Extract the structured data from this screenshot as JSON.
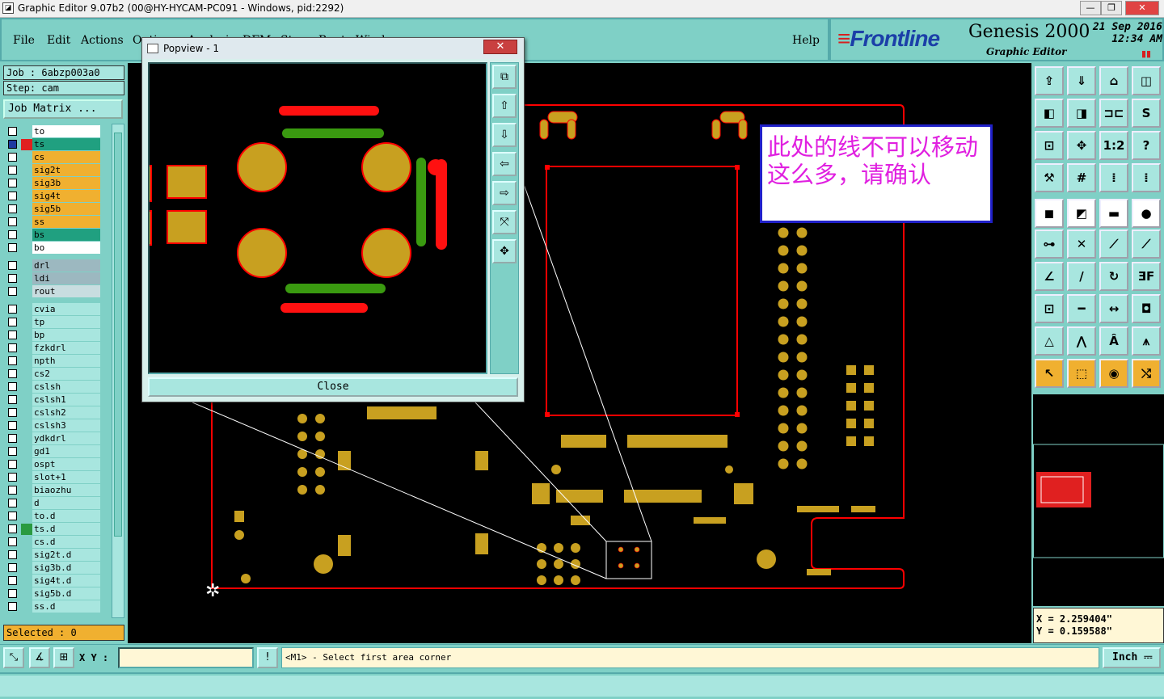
{
  "window": {
    "title": "Graphic Editor 9.07b2 (00@HY-HYCAM-PC091 - Windows, pid:2292)",
    "min": "—",
    "max": "❐",
    "close": "✕"
  },
  "menu": {
    "items": [
      "File",
      "Edit",
      "Actions",
      "Options",
      "Analysis",
      "DFM",
      "Step",
      "Rout",
      "Window"
    ],
    "help": "Help"
  },
  "brand": {
    "logo": "Frontline",
    "product": "Genesis 2000",
    "subtitle": "Graphic Editor",
    "date": "21 Sep 2016",
    "time": "12:34 AM"
  },
  "job": {
    "job_line": "Job : 6abzp003a0",
    "step_line": "Step: cam",
    "job_matrix": "Job Matrix ..."
  },
  "layers": [
    {
      "name": "to",
      "color": "#ffffff"
    },
    {
      "name": "ts",
      "color": "#20a080",
      "active": true
    },
    {
      "name": "cs",
      "color": "#f0b030"
    },
    {
      "name": "sig2t",
      "color": "#f0b030"
    },
    {
      "name": "sig3b",
      "color": "#f0b030"
    },
    {
      "name": "sig4t",
      "color": "#f0b030"
    },
    {
      "name": "sig5b",
      "color": "#f0b030"
    },
    {
      "name": "ss",
      "color": "#f0b030"
    },
    {
      "name": "bs",
      "color": "#20a080"
    },
    {
      "name": "bo",
      "color": "#ffffff"
    },
    {
      "name": "drl",
      "color": "#9cb8c0"
    },
    {
      "name": "ldi",
      "color": "#9cb8c0"
    },
    {
      "name": "rout",
      "color": "#c8dde0"
    },
    {
      "name": "cvia",
      "color": "#a8e6df"
    },
    {
      "name": "tp",
      "color": "#a8e6df"
    },
    {
      "name": "bp",
      "color": "#a8e6df"
    },
    {
      "name": "fzkdrl",
      "color": "#a8e6df"
    },
    {
      "name": "npth",
      "color": "#a8e6df"
    },
    {
      "name": "cs2",
      "color": "#a8e6df"
    },
    {
      "name": "cslsh",
      "color": "#a8e6df"
    },
    {
      "name": "cslsh1",
      "color": "#a8e6df"
    },
    {
      "name": "cslsh2",
      "color": "#a8e6df"
    },
    {
      "name": "cslsh3",
      "color": "#a8e6df"
    },
    {
      "name": "ydkdrl",
      "color": "#a8e6df"
    },
    {
      "name": "gd1",
      "color": "#a8e6df"
    },
    {
      "name": "ospt",
      "color": "#a8e6df"
    },
    {
      "name": "slot+1",
      "color": "#a8e6df"
    },
    {
      "name": "biaozhu",
      "color": "#a8e6df"
    },
    {
      "name": "d",
      "color": "#a8e6df"
    },
    {
      "name": "to.d",
      "color": "#a8e6df"
    },
    {
      "name": "ts.d",
      "color": "#a8e6df"
    },
    {
      "name": "cs.d",
      "color": "#a8e6df"
    },
    {
      "name": "sig2t.d",
      "color": "#a8e6df"
    },
    {
      "name": "sig3b.d",
      "color": "#a8e6df"
    },
    {
      "name": "sig4t.d",
      "color": "#a8e6df"
    },
    {
      "name": "sig5b.d",
      "color": "#a8e6df"
    },
    {
      "name": "ss.d",
      "color": "#a8e6df"
    }
  ],
  "selected_label": "Selected : 0",
  "popview": {
    "title": "Popview - 1",
    "close_x": "✕",
    "close_label": "Close"
  },
  "note": "此处的线不可以移动这么多，请确认",
  "coords": {
    "x": "X = 2.259404\"",
    "y": "Y = 0.159588\""
  },
  "status": {
    "xy_label": "X Y :",
    "xy_value": "",
    "message": "<M1> - Select first area corner",
    "unit": "Inch",
    "alert": "!"
  },
  "colors": {
    "panel": "#7fd0c6",
    "pad": "#c8a020",
    "outline": "#ff0000",
    "trace_green": "#3a9a10",
    "note_text": "#e020e0"
  }
}
